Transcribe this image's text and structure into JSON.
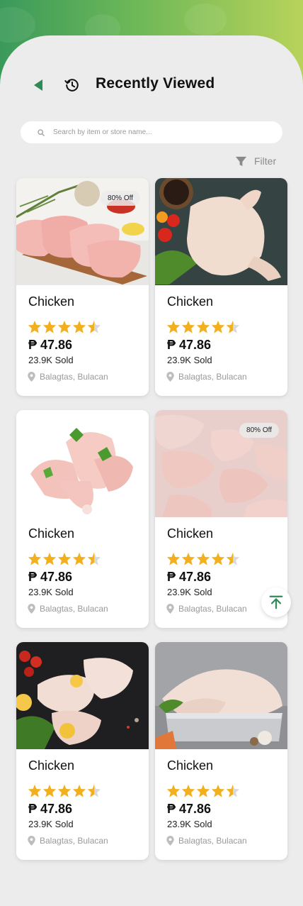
{
  "header": {
    "title": "Recently Viewed",
    "back_icon": "back-arrow-icon",
    "history_icon": "history-icon"
  },
  "search": {
    "placeholder": "Search by item or store name...",
    "value": ""
  },
  "filter": {
    "label": "Filter"
  },
  "colors": {
    "accent_green": "#2e8b57",
    "star": "#f2b01e",
    "gradient_start": "#3a9a5a",
    "gradient_end": "#b8d35a"
  },
  "products": [
    {
      "name": "Chicken",
      "badge": "80% Off",
      "rating": 4.5,
      "price": "₱ 47.86",
      "sold": "23.9K Sold",
      "location": "Balagtas, Bulacan"
    },
    {
      "name": "Chicken",
      "badge": "",
      "rating": 4.5,
      "price": "₱ 47.86",
      "sold": "23.9K Sold",
      "location": "Balagtas, Bulacan"
    },
    {
      "name": "Chicken",
      "badge": "",
      "rating": 4.5,
      "price": "₱ 47.86",
      "sold": "23.9K Sold",
      "location": "Balagtas, Bulacan"
    },
    {
      "name": "Chicken",
      "badge": "80% Off",
      "rating": 4.5,
      "price": "₱ 47.86",
      "sold": "23.9K Sold",
      "location": "Balagtas, Bulacan"
    },
    {
      "name": "Chicken",
      "badge": "",
      "rating": 4.5,
      "price": "₱ 47.86",
      "sold": "23.9K Sold",
      "location": "Balagtas, Bulacan"
    },
    {
      "name": "Chicken",
      "badge": "",
      "rating": 4.5,
      "price": "₱ 47.86",
      "sold": "23.9K Sold",
      "location": "Balagtas, Bulacan"
    }
  ],
  "scroll_top_icon": "arrow-up-to-top-icon"
}
